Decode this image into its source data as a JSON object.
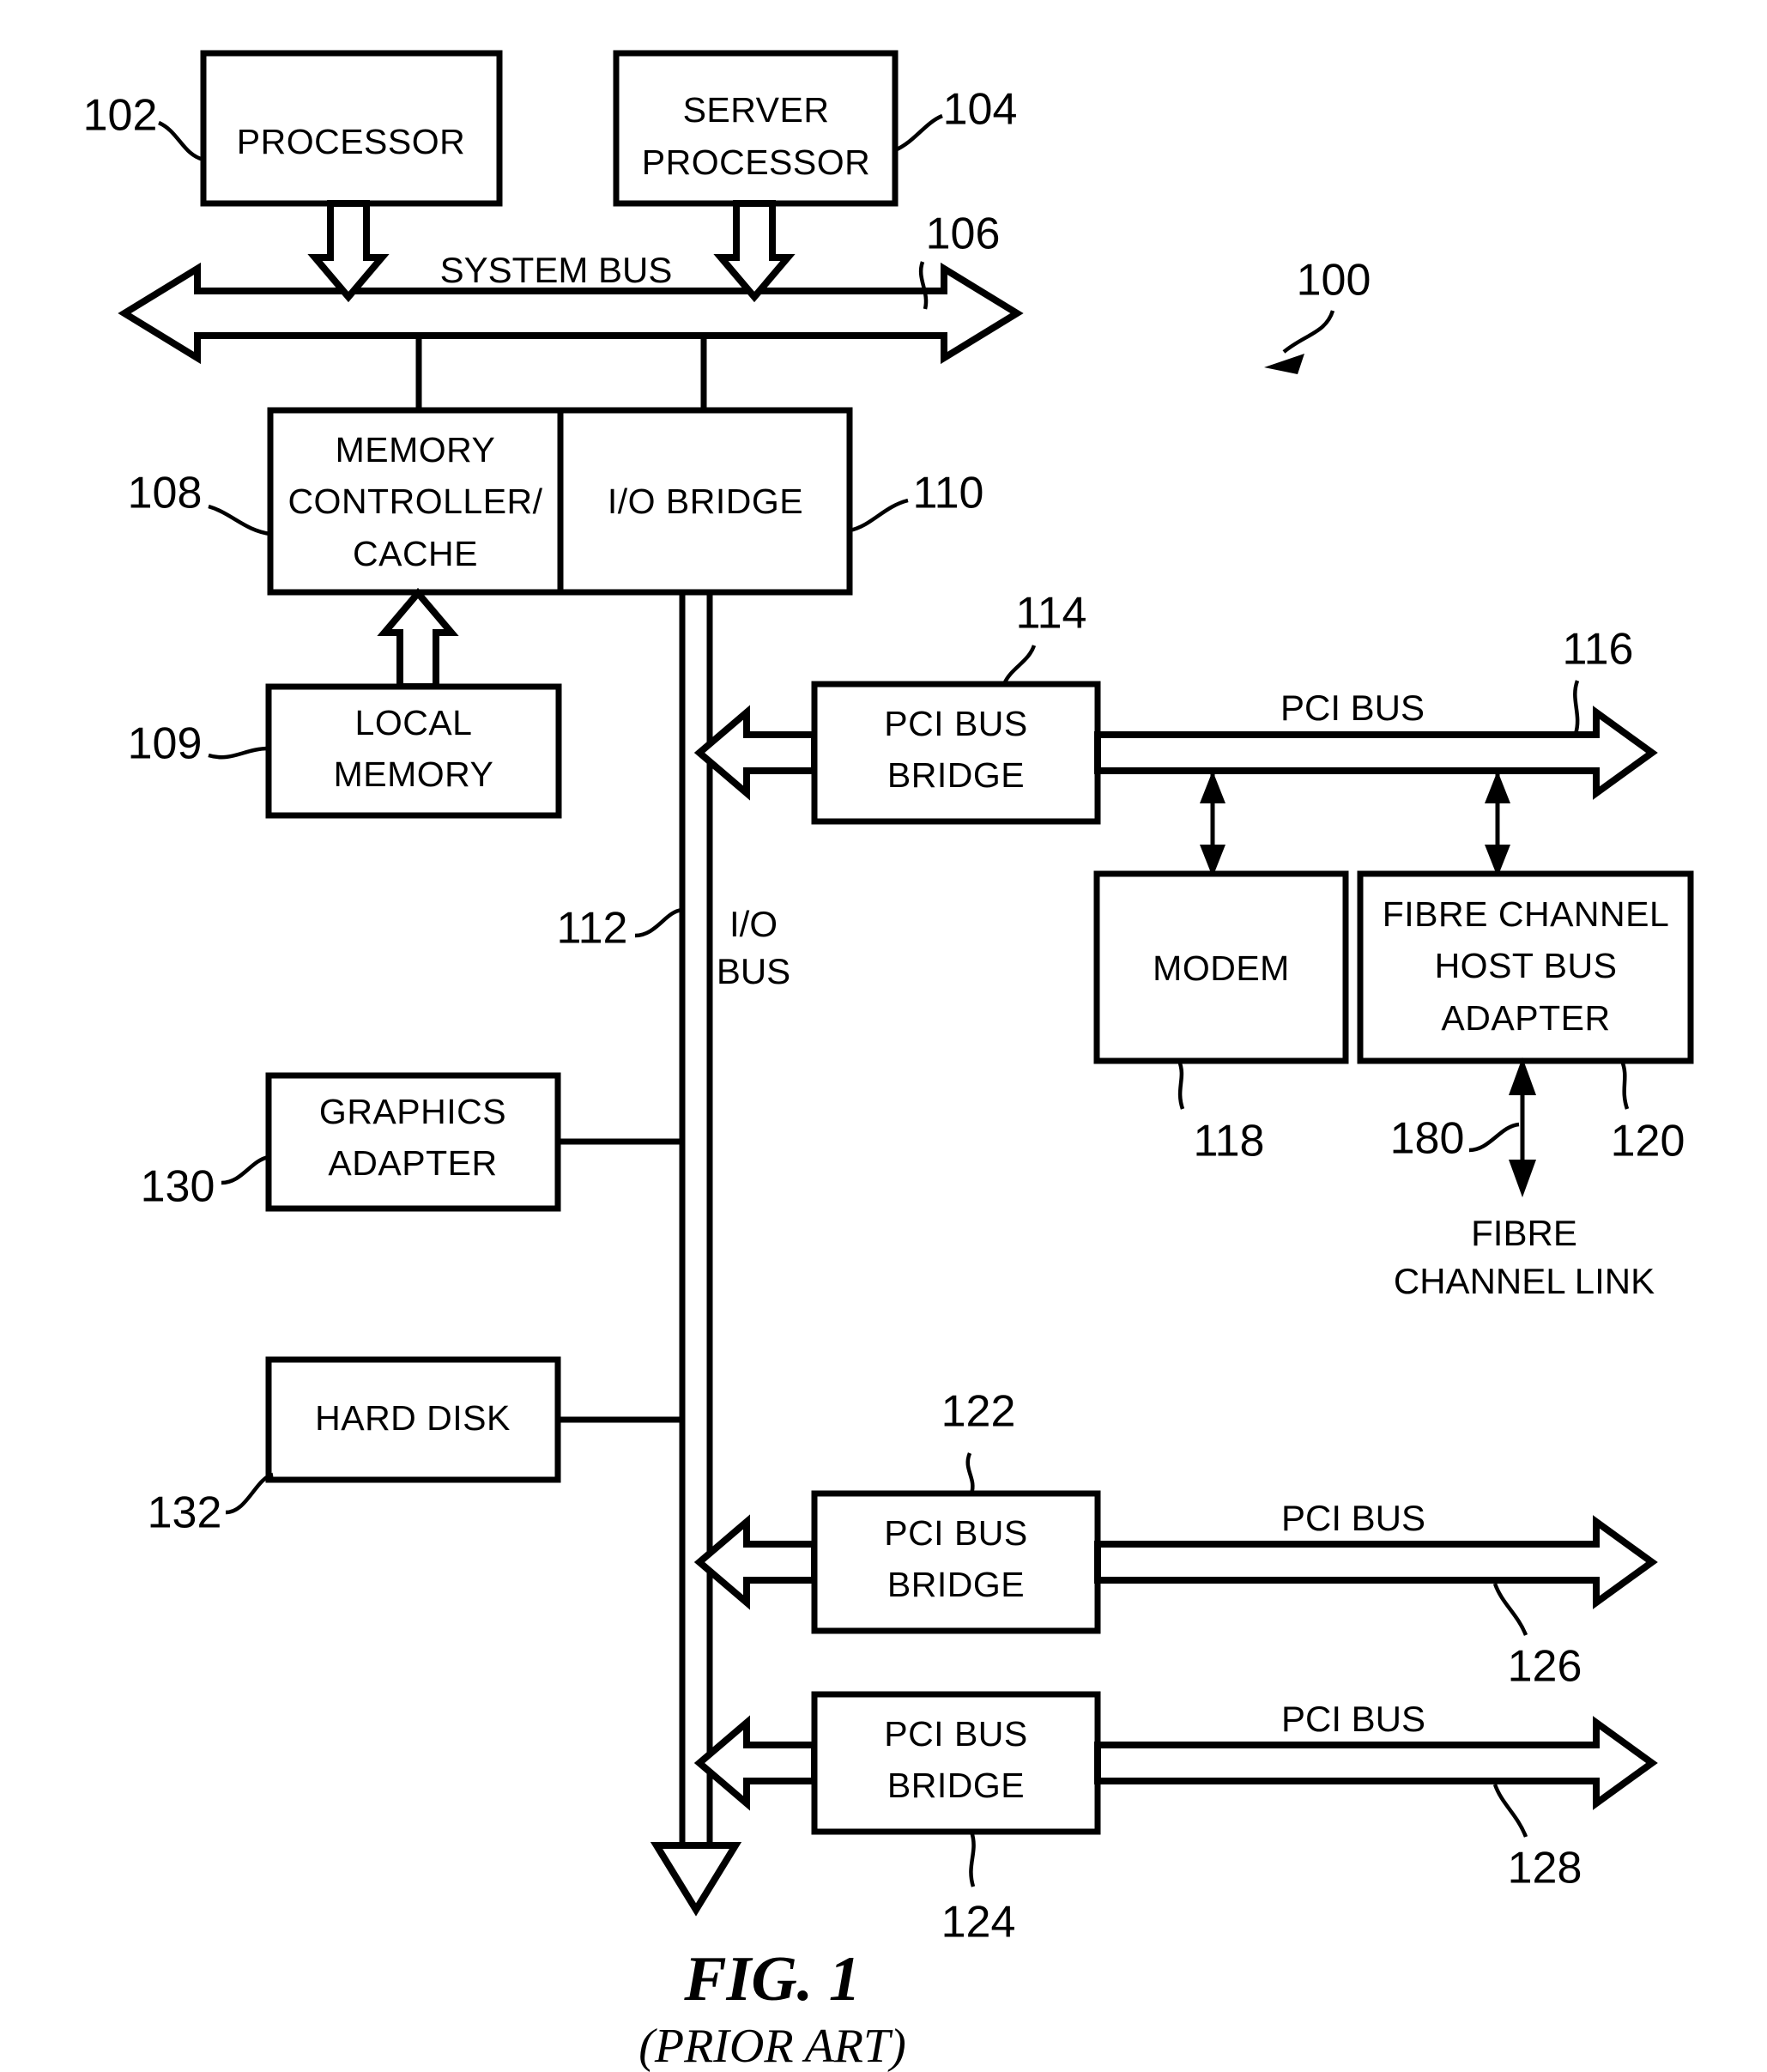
{
  "figure": {
    "title": "FIG. 1",
    "subtitle": "(PRIOR ART)",
    "system_ref": "100"
  },
  "blocks": {
    "processor": {
      "label": "PROCESSOR",
      "ref": "102"
    },
    "server_processor": {
      "label_line1": "SERVER",
      "label_line2": "PROCESSOR",
      "ref": "104"
    },
    "memory_controller": {
      "label_line1": "MEMORY",
      "label_line2": "CONTROLLER/",
      "label_line3": "CACHE",
      "ref": "108"
    },
    "io_bridge": {
      "label": "I/O BRIDGE",
      "ref": "110"
    },
    "local_memory": {
      "label_line1": "LOCAL",
      "label_line2": "MEMORY",
      "ref": "109"
    },
    "pci_bus_bridge_1": {
      "label_line1": "PCI BUS",
      "label_line2": "BRIDGE",
      "ref": "114"
    },
    "pci_bus_bridge_2": {
      "label_line1": "PCI BUS",
      "label_line2": "BRIDGE",
      "ref": "122"
    },
    "pci_bus_bridge_3": {
      "label_line1": "PCI BUS",
      "label_line2": "BRIDGE",
      "ref": "124"
    },
    "modem": {
      "label": "MODEM",
      "ref": "118"
    },
    "fibre_channel_adapter": {
      "label_line1": "FIBRE CHANNEL",
      "label_line2": "HOST BUS",
      "label_line3": "ADAPTER",
      "ref": "120"
    },
    "graphics_adapter": {
      "label_line1": "GRAPHICS",
      "label_line2": "ADAPTER",
      "ref": "130"
    },
    "hard_disk": {
      "label": "HARD DISK",
      "ref": "132"
    }
  },
  "buses": {
    "system_bus": {
      "label": "SYSTEM BUS",
      "ref": "106"
    },
    "io_bus": {
      "label_line1": "I/O",
      "label_line2": "BUS",
      "ref": "112"
    },
    "pci_bus_116": {
      "label": "PCI BUS",
      "ref": "116"
    },
    "pci_bus_126": {
      "label": "PCI BUS",
      "ref": "126"
    },
    "pci_bus_128": {
      "label": "PCI BUS",
      "ref": "128"
    },
    "fibre_channel_link": {
      "label_line1": "FIBRE",
      "label_line2": "CHANNEL LINK",
      "ref": "180"
    }
  },
  "colors": {
    "ink": "#000000",
    "paper": "#ffffff"
  }
}
